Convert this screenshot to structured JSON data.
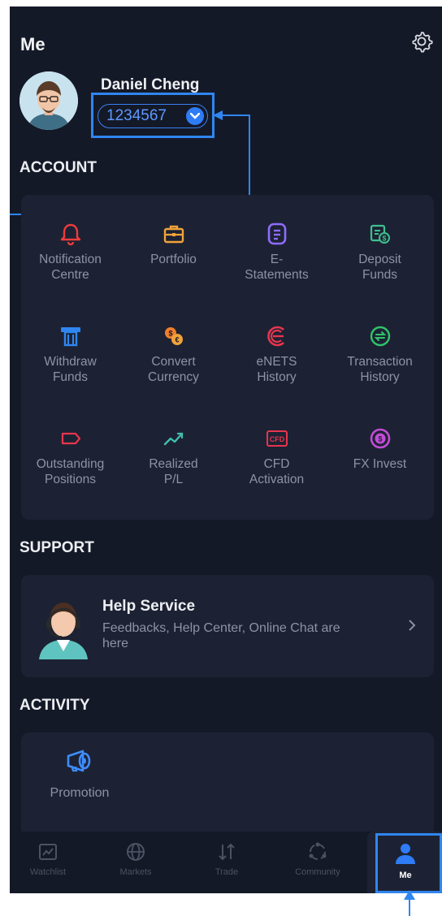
{
  "header": {
    "title": "Me"
  },
  "profile": {
    "name": "Daniel Cheng",
    "account_number": "1234567"
  },
  "sections": {
    "account": "ACCOUNT",
    "support": "SUPPORT",
    "activity": "ACTIVITY"
  },
  "account_items": [
    {
      "label": "Notification\nCentre",
      "icon": "bell-icon"
    },
    {
      "label": "Portfolio",
      "icon": "briefcase-icon"
    },
    {
      "label": "E-\nStatements",
      "icon": "document-icon"
    },
    {
      "label": "Deposit\nFunds",
      "icon": "deposit-icon"
    },
    {
      "label": "Withdraw\nFunds",
      "icon": "atm-icon"
    },
    {
      "label": "Convert\nCurrency",
      "icon": "currency-exchange-icon"
    },
    {
      "label": "eNETS\nHistory",
      "icon": "enets-icon"
    },
    {
      "label": "Transaction\nHistory",
      "icon": "transfer-icon"
    },
    {
      "label": "Outstanding\nPositions",
      "icon": "tag-icon"
    },
    {
      "label": "Realized\nP/L",
      "icon": "trend-line-icon"
    },
    {
      "label": "CFD\nActivation",
      "icon": "cfd-icon"
    },
    {
      "label": "FX Invest",
      "icon": "fx-coin-icon"
    }
  ],
  "support": {
    "title": "Help Service",
    "subtitle": "Feedbacks, Help Center, Online Chat are here"
  },
  "activity": {
    "promotion": "Promotion"
  },
  "nav": [
    {
      "label": "Watchlist",
      "icon": "chart-icon"
    },
    {
      "label": "Markets",
      "icon": "globe-icon"
    },
    {
      "label": "Trade",
      "icon": "sort-arrows-icon"
    },
    {
      "label": "Community",
      "icon": "community-icon"
    },
    {
      "label": "Me",
      "icon": "person-icon",
      "active": true
    }
  ],
  "colors": {
    "background": "#141927",
    "card": "#1c2233",
    "accent_blue": "#2e7cf6",
    "text_muted": "#8c93a5",
    "highlight": "#2f86f0"
  }
}
